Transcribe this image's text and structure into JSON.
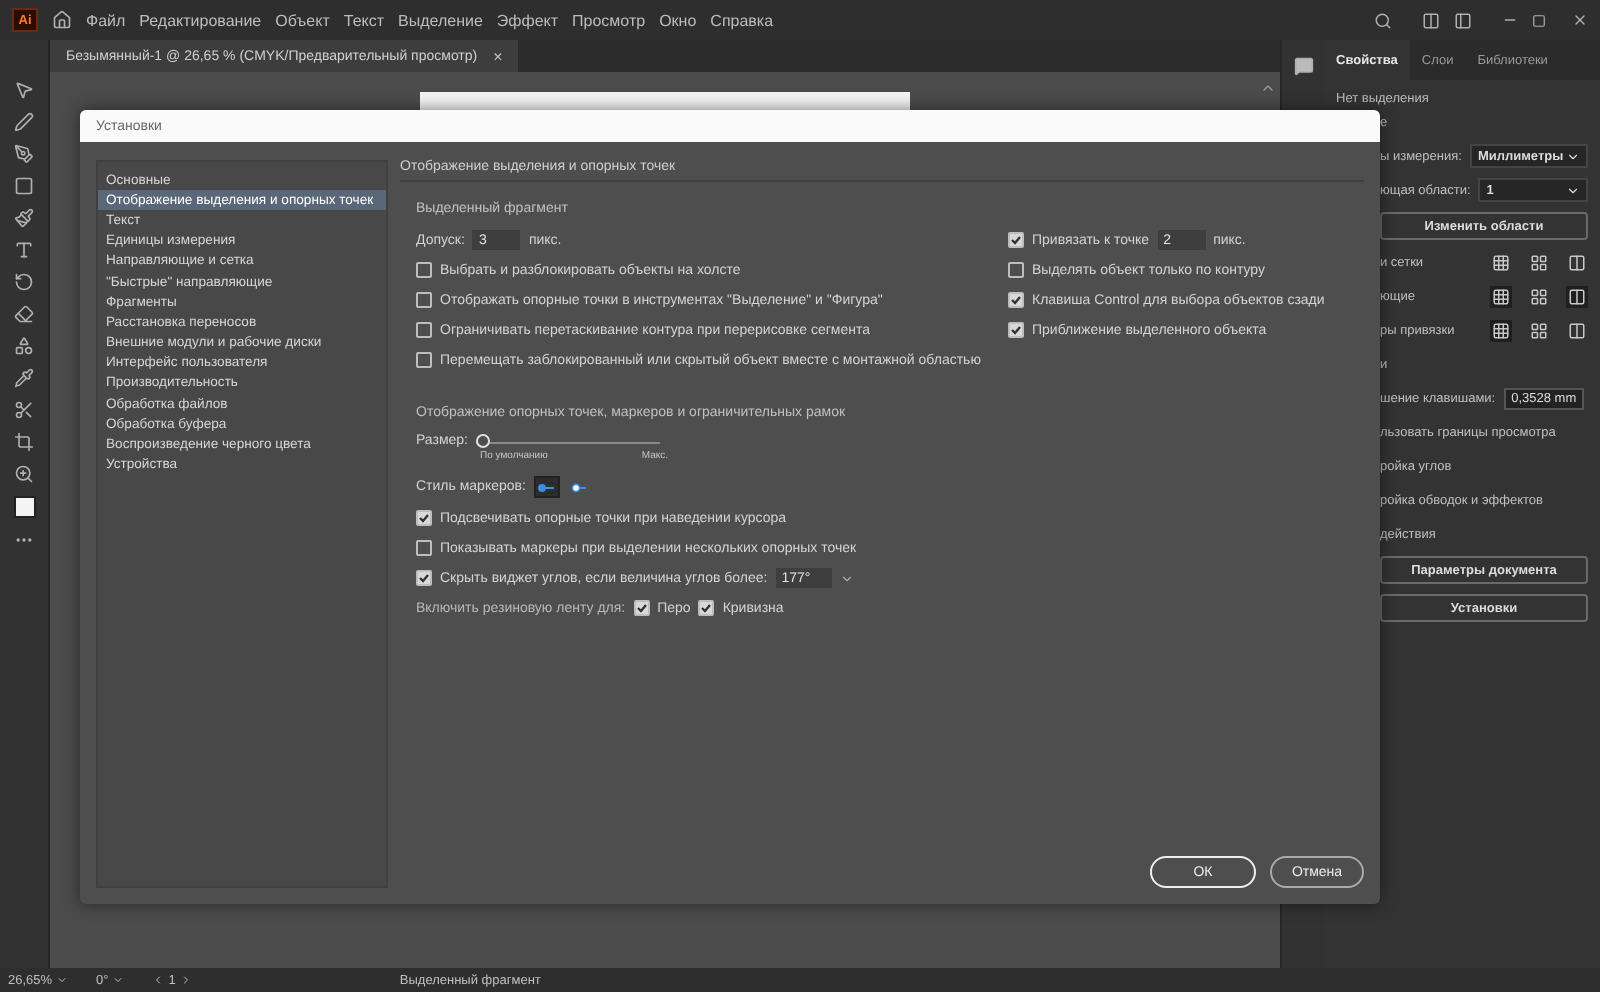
{
  "app": {
    "logo": "Ai",
    "menu": [
      "Файл",
      "Редактирование",
      "Объект",
      "Текст",
      "Выделение",
      "Эффект",
      "Просмотр",
      "Окно",
      "Справка"
    ]
  },
  "document_tab": {
    "title": "Безымянный-1 @ 26,65 % (CMYK/Предварительный просмотр)",
    "close": "×"
  },
  "dialog": {
    "title": "Установки",
    "categories": [
      {
        "label": "Основные",
        "selected": false
      },
      {
        "label": "Отображение выделения и опорных точек",
        "selected": true
      },
      {
        "label": "Текст",
        "selected": false
      },
      {
        "label": "Единицы измерения",
        "selected": false
      },
      {
        "label": "Направляющие и сетка",
        "selected": false
      },
      {
        "label": "\"Быстрые\" направляющие",
        "selected": false
      },
      {
        "label": "Фрагменты",
        "selected": false
      },
      {
        "label": "Расстановка переносов",
        "selected": false
      },
      {
        "label": "Внешние модули и рабочие диски",
        "selected": false
      },
      {
        "label": "Интерфейс пользователя",
        "selected": false
      },
      {
        "label": "Производительность",
        "selected": false
      },
      {
        "label": "Обработка файлов",
        "selected": false
      },
      {
        "label": "Обработка буфера",
        "selected": false
      },
      {
        "label": "Воспроизведение черного цвета",
        "selected": false
      },
      {
        "label": "Устройства",
        "selected": false
      }
    ],
    "section_title": "Отображение выделения и опорных точек",
    "selection": {
      "heading": "Выделенный фрагмент",
      "tolerance": {
        "label": "Допуск:",
        "value": "3",
        "unit": "пикс."
      },
      "snap": {
        "label": "Привязать к точке",
        "checked": true,
        "value": "2",
        "unit": "пикс."
      },
      "left_options": [
        {
          "label": "Выбрать и разблокировать объекты на холсте",
          "checked": false
        },
        {
          "label": "Отображать опорные точки в инструментах \"Выделение\" и \"Фигура\"",
          "checked": false
        },
        {
          "label": "Ограничивать перетаскивание контура при перерисовке сегмента",
          "checked": false
        },
        {
          "label": "Перемещать заблокированный или скрытый объект вместе с монтажной областью",
          "checked": false
        }
      ],
      "right_options": [
        {
          "label": "Выделять объект только по контуру",
          "checked": false
        },
        {
          "label": "Клавиша Control для выбора объектов сзади",
          "checked": true
        },
        {
          "label": "Приближение выделенного объекта",
          "checked": true
        }
      ]
    },
    "anchors": {
      "heading": "Отображение опорных точек, маркеров и ограничительных рамок",
      "size": {
        "label": "Размер:",
        "level": 0,
        "min_label": "По умолчанию",
        "max_label": "Макс."
      },
      "marker_style": {
        "label": "Стиль маркеров:",
        "styles": [
          {
            "kind": "solid",
            "selected": true
          },
          {
            "kind": "hollow",
            "selected": false
          }
        ]
      },
      "options": [
        {
          "label": "Подсвечивать опорные точки при наведении курсора",
          "checked": true
        },
        {
          "label": "Показывать маркеры при выделении нескольких опорных точек",
          "checked": false
        }
      ],
      "hide_widget": {
        "label": "Скрыть виджет углов, если величина углов более:",
        "checked": true,
        "value": "177°"
      },
      "rubber_band": {
        "label": "Включить резиновую ленту для:",
        "items": [
          {
            "label": "Перо",
            "checked": true
          },
          {
            "label": "Кривизна",
            "checked": true
          }
        ]
      }
    },
    "buttons": [
      {
        "label": "ОК",
        "primary": true
      },
      {
        "label": "Отмена",
        "primary": false
      }
    ]
  },
  "panel": {
    "tabs": [
      {
        "label": "Свойства",
        "selected": true
      },
      {
        "label": "Слои",
        "selected": false
      },
      {
        "label": "Библиотеки",
        "selected": false
      }
    ],
    "no_selection": "Нет выделения",
    "rows": [
      {
        "kind": "text",
        "label": "е"
      },
      {
        "kind": "select",
        "label": "ы измерения:",
        "value": "Миллиметры"
      },
      {
        "kind": "select",
        "label": "ющая области:",
        "value": "1"
      },
      {
        "kind": "button",
        "label": "Изменить области"
      },
      {
        "kind": "icons",
        "label": "и сетки",
        "icons": [
          {
            "selected": false
          },
          {
            "selected": false
          },
          {
            "selected": false
          }
        ]
      },
      {
        "kind": "icons",
        "label": "ющие",
        "icons": [
          {
            "selected": true
          },
          {
            "selected": false
          },
          {
            "selected": true
          }
        ]
      },
      {
        "kind": "icons",
        "label": "ры привязки",
        "icons": [
          {
            "selected": true
          },
          {
            "selected": false
          },
          {
            "selected": false
          }
        ]
      },
      {
        "kind": "text",
        "label": "и"
      },
      {
        "kind": "field",
        "label": "шение клавишами:",
        "value": "0,3528 mm"
      },
      {
        "kind": "text",
        "label": "льзовать границы просмотра"
      },
      {
        "kind": "text",
        "label": "ройка углов"
      },
      {
        "kind": "text",
        "label": "ройка обводок и эффектов"
      },
      {
        "kind": "text",
        "label": "действия"
      },
      {
        "kind": "button",
        "label": "Параметры документа"
      },
      {
        "kind": "button",
        "label": "Установки"
      }
    ]
  },
  "status_bar": {
    "zoom": "26,65%",
    "angle": "0°",
    "artboard": "1",
    "tool": "Выделенный фрагмент"
  }
}
